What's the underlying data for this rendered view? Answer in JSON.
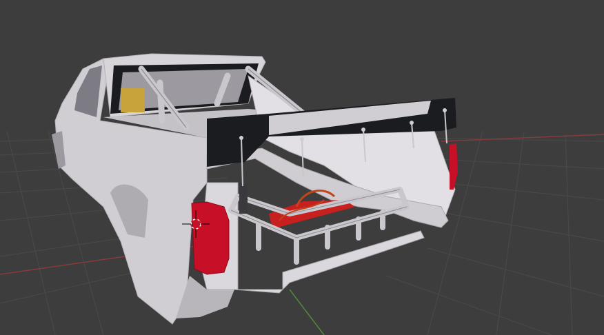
{
  "viewport": {
    "background_color": "#3d3d3d",
    "grid_line_color": "#4a4a4a",
    "x_axis_color": "#8a3a3a",
    "y_axis_color": "#4f8a3a"
  },
  "scene": {
    "body_color": "#d6d4d8",
    "body_shadow_color": "#a9a7ad",
    "spoiler_color": "#1b1c20",
    "taillight_color": "#c80f28",
    "bed_floor_color": "#c81f1f",
    "tube_color": "#c9c7cc",
    "hose_color": "#c0451a",
    "seat_color": "#c8a23a"
  },
  "cursor": {
    "icon": "3d-cursor-icon"
  }
}
